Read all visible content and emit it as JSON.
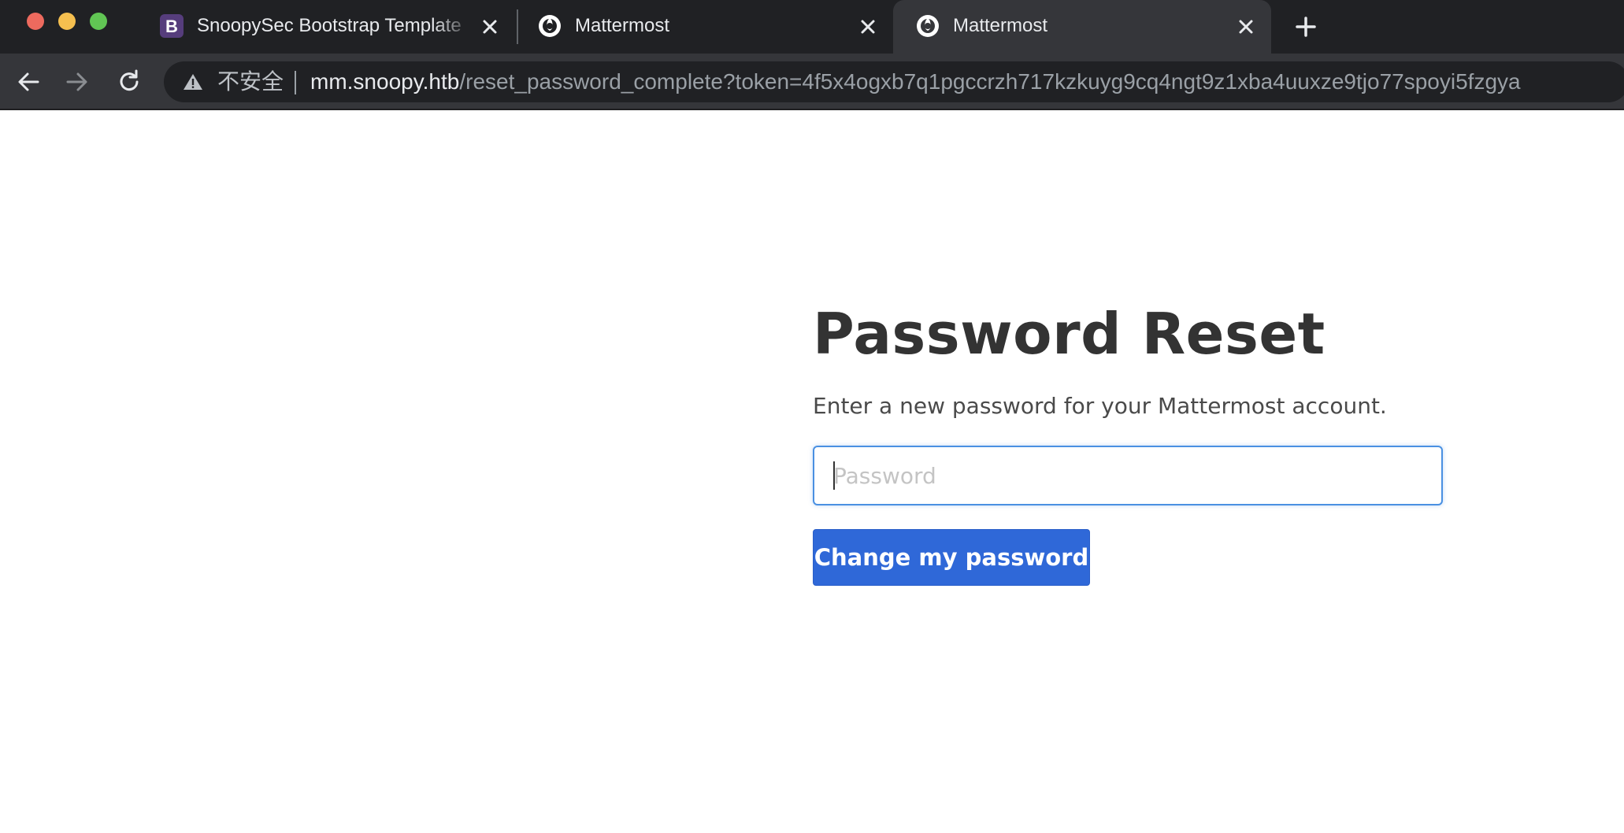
{
  "browser": {
    "tabs": [
      {
        "title": "SnoopySec Bootstrap Template",
        "favicon": "bootstrap-icon",
        "active": false
      },
      {
        "title": "Mattermost",
        "favicon": "mattermost-icon",
        "active": false
      },
      {
        "title": "Mattermost",
        "favicon": "mattermost-icon",
        "active": true
      }
    ],
    "address_bar": {
      "security_label": "不安全",
      "host": "mm.snoopy.htb",
      "path": "/reset_password_complete?token=4f5x4ogxb7q1pgccrzh717kzkuyg9cq4ngt9z1xba4uuxze9tjo77spoyi5fzgya"
    },
    "colors": {
      "tabstrip_bg": "#202124",
      "toolbar_bg": "#35363a",
      "bootstrap_purple": "#563d7c"
    }
  },
  "page": {
    "title": "Password Reset",
    "description": "Enter a new password for your Mattermost account.",
    "password_field": {
      "placeholder": "Password",
      "value": ""
    },
    "submit_label": "Change my password",
    "colors": {
      "button_bg": "#2f68d8",
      "input_focus_border": "#4a90e2",
      "heading": "#333333"
    }
  }
}
